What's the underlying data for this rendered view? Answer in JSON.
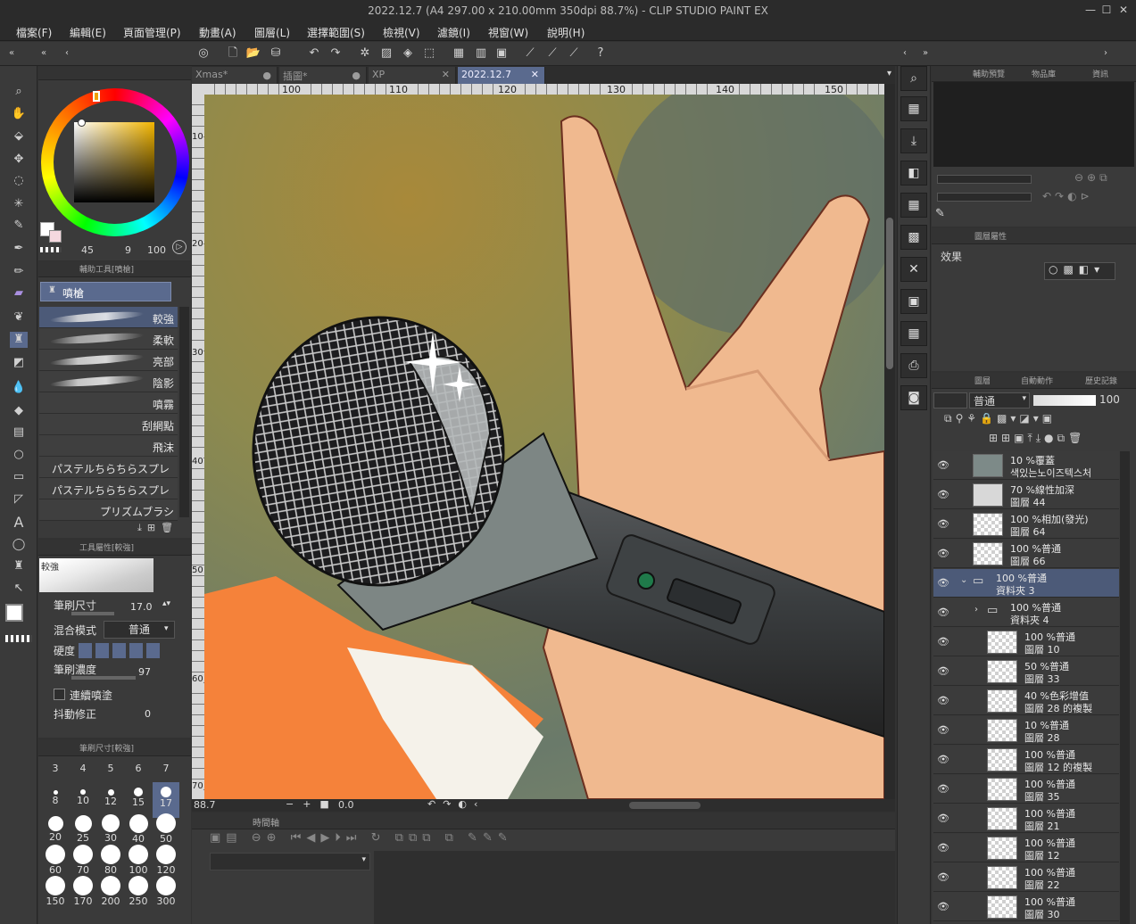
{
  "window": {
    "title": "2022.12.7 (A4 297.00 x 210.00mm 350dpi 88.7%)  - CLIP STUDIO PAINT EX"
  },
  "menu": [
    "檔案(F)",
    "編輯(E)",
    "頁面管理(P)",
    "動畫(A)",
    "圖層(L)",
    "選擇範圍(S)",
    "檢視(V)",
    "濾鏡(I)",
    "視窗(W)",
    "說明(H)"
  ],
  "tabs": [
    {
      "label": "Xmas*"
    },
    {
      "label": "插圖*"
    },
    {
      "label": "XP"
    },
    {
      "label": "2022.12.7"
    }
  ],
  "ruler": {
    "top": [
      "100",
      "110",
      "120",
      "130",
      "140",
      "150"
    ],
    "left": [
      "10",
      "20",
      "30",
      "40",
      "50",
      "60",
      "70"
    ]
  },
  "color_panel": {
    "size_a": "45",
    "size_b": "9",
    "size_c": "100"
  },
  "sub_tool_panel": {
    "title": "輔助工具[噴槍]",
    "group": "噴槍",
    "brushes": [
      "較強",
      "柔軟",
      "亮部",
      "陰影",
      "噴霧",
      "刮網點",
      "飛沫",
      "パステルちらちらスプレ",
      "パステルちらちらスプレ",
      "プリズムブラシ"
    ]
  },
  "tool_property": {
    "title": "工具屬性[較強]",
    "preview_label": "較強",
    "brush_size_label": "筆刷尺寸",
    "brush_size_value": "17.0",
    "blend_label": "混合模式",
    "blend_value": "普通",
    "hardness_label": "硬度",
    "density_label": "筆刷濃度",
    "density_value": "97",
    "continuous_label": "連續噴塗",
    "stabilize_label": "抖動修正",
    "stabilize_value": "0"
  },
  "brush_size_panel": {
    "title": "筆刷尺寸[較強]",
    "sizes": [
      "3",
      "4",
      "5",
      "6",
      "7",
      "8",
      "10",
      "12",
      "15",
      "17",
      "20",
      "25",
      "30",
      "40",
      "50",
      "60",
      "70",
      "80",
      "100",
      "120",
      "150",
      "170",
      "200",
      "250",
      "300"
    ],
    "selected": "17"
  },
  "status": {
    "zoom": "88.7",
    "angle": "0.0"
  },
  "timeline": {
    "title": "時間軸"
  },
  "navigator": {
    "tabs": [
      "輔助預覽",
      "物品庫",
      "資訊"
    ]
  },
  "layer_property": {
    "title": "圖層屬性",
    "effect_label": "效果"
  },
  "layer_panel": {
    "tabs": [
      "圖層",
      "自動動作",
      "歷史記錄"
    ],
    "blend_mode": "普通",
    "opacity": "100",
    "layers": [
      {
        "line1": "10 %覆蓋",
        "line2": "색있는노이즈텍스처",
        "indent": 0
      },
      {
        "line1": "70 %線性加深",
        "line2": "圖層 44",
        "indent": 0
      },
      {
        "line1": "100 %相加(發光)",
        "line2": "圖層 64",
        "indent": 0
      },
      {
        "line1": "100 %普通",
        "line2": "圖層 66",
        "indent": 0
      },
      {
        "line1": "100 %普通",
        "line2": "資料夾 3",
        "indent": 0
      },
      {
        "line1": "100 %普通",
        "line2": "資料夾 4",
        "indent": 1
      },
      {
        "line1": "100 %普通",
        "line2": "圖層 10",
        "indent": 1
      },
      {
        "line1": "50 %普通",
        "line2": "圖層 33",
        "indent": 1
      },
      {
        "line1": "40 %色彩增值",
        "line2": "圖層 28 的複製",
        "indent": 1
      },
      {
        "line1": "10 %普通",
        "line2": "圖層 28",
        "indent": 1
      },
      {
        "line1": "100 %普通",
        "line2": "圖層 12 的複製",
        "indent": 1
      },
      {
        "line1": "100 %普通",
        "line2": "圖層 35",
        "indent": 1
      },
      {
        "line1": "100 %普通",
        "line2": "圖層 21",
        "indent": 1
      },
      {
        "line1": "100 %普通",
        "line2": "圖層 12",
        "indent": 1
      },
      {
        "line1": "100 %普通",
        "line2": "圖層 22",
        "indent": 1
      },
      {
        "line1": "100 %普通",
        "line2": "圖層 30",
        "indent": 1
      }
    ]
  },
  "colors": {
    "accent": "#5a6a8e",
    "selected_layer": "#4c5a78",
    "panel": "#3a3a3a"
  }
}
